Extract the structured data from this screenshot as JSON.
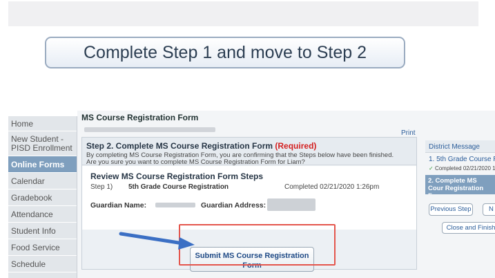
{
  "banner": {
    "cta_label": "Complete Step 1 and move to Step 2"
  },
  "sidebar": {
    "items": [
      {
        "label": "Home"
      },
      {
        "label": "New Student - PISD Enrollment"
      },
      {
        "label": "Online Forms",
        "active": true
      },
      {
        "label": "Calendar"
      },
      {
        "label": "Gradebook"
      },
      {
        "label": "Attendance"
      },
      {
        "label": "Student Info"
      },
      {
        "label": "Food Service"
      },
      {
        "label": "Schedule"
      }
    ]
  },
  "main": {
    "title": "MS Course Registration Form",
    "print_label": "Print",
    "step_heading": "Step 2. Complete MS Course Registration Form",
    "required_label": "(Required)",
    "confirm_line1": "By completing MS Course Registration Form, you are confirming that the Steps below have been finished.",
    "confirm_line2": "Are you sure you want to complete MS Course Registration Form for Liam?",
    "review_heading": "Review MS Course Registration Form Steps",
    "steps": [
      {
        "label": "Step 1)",
        "name": "5th Grade Course Registration",
        "status": "Completed 02/21/2020 1:26pm"
      }
    ],
    "guardian_name_label": "Guardian Name:",
    "guardian_address_label": "Guardian Address:",
    "submit_label": "Submit MS Course Registration Form"
  },
  "right_panel": {
    "district_message": "District Message",
    "step1_link": "1. 5th Grade Course Re",
    "step1_completed": "Completed 02/21/2020 1",
    "step2_active": "2. Complete MS Cour Registration Form",
    "previous_step": "Previous Step",
    "next_step": "N",
    "close_finish": "Close and Finish"
  },
  "colors": {
    "accent": "#7f9fbe",
    "required": "#d42020",
    "link": "#2b5d9a",
    "highlight": "#e4554c",
    "arrow": "#3b6fc4"
  }
}
